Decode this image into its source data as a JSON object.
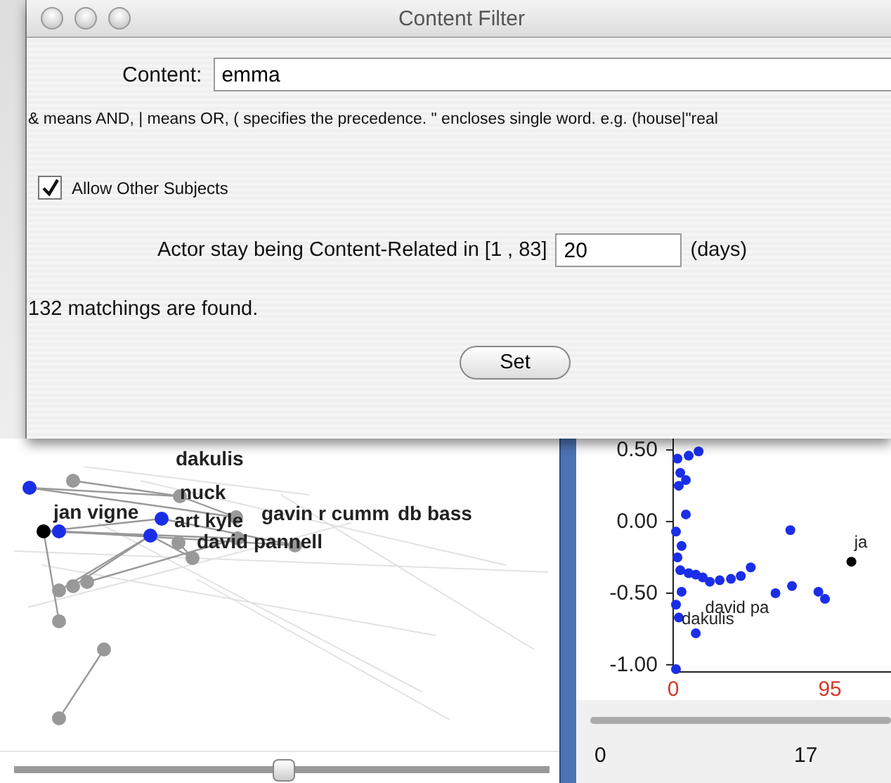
{
  "window": {
    "title": "Content Filter"
  },
  "content_field": {
    "label": "Content:",
    "value": "emma"
  },
  "hint": "& means AND, | means OR, ( specifies the precedence. \" encloses single word. e.g. (house|\"real",
  "allow_other_subjects": {
    "label": "Allow Other Subjects",
    "checked": true
  },
  "duration": {
    "label": "Actor stay being Content-Related in [1 , 83]",
    "value": "20",
    "unit": "(days)"
  },
  "result": "132 matchings are found.",
  "set_button": "Set",
  "network": {
    "labels": [
      "dakulis",
      "nuck",
      "jan vigne",
      "art kyle",
      "gavin r cumm",
      "db bass",
      "david pannell"
    ],
    "slider": {
      "level": 0.5
    }
  },
  "scatter": {
    "chart_data": {
      "type": "scatter",
      "xlim": [
        0,
        132
      ],
      "ylim": [
        -1.05,
        0.56
      ],
      "xticks": [
        {
          "value": 0,
          "label": "0"
        },
        {
          "value": 95,
          "label": "95"
        }
      ],
      "yticks": [
        {
          "value": 0.5,
          "label": "0.50"
        },
        {
          "value": 0,
          "label": "0.00"
        },
        {
          "value": -0.5,
          "label": "-0.50"
        },
        {
          "value": -1,
          "label": "-1.00"
        }
      ],
      "series": [
        {
          "color": "#1a2ee8",
          "x": [
            2.6,
            9.4,
            15.4,
            4.3,
            7.7,
            3.4,
            7.7,
            1.7,
            5.1,
            2.6,
            4.3,
            9.4,
            13.7,
            17.9,
            22.2,
            28.2,
            35,
            41,
            47,
            5.1,
            1.7,
            3.4,
            13.7,
            1.7,
            71,
            62,
            72,
            88,
            92
          ],
          "values": [
            0.44,
            0.46,
            0.49,
            0.34,
            0.29,
            0.25,
            0.05,
            -0.07,
            -0.17,
            -0.25,
            -0.34,
            -0.36,
            -0.37,
            -0.39,
            -0.42,
            -0.41,
            -0.4,
            -0.38,
            -0.32,
            -0.49,
            -0.58,
            -0.67,
            -0.78,
            -1.03,
            -0.06,
            -0.5,
            -0.45,
            -0.49,
            -0.54
          ]
        },
        {
          "color": "#000000",
          "x": [
            108
          ],
          "values": [
            -0.28
          ]
        }
      ],
      "annotations": [
        {
          "x": 1.7,
          "y": -0.58,
          "text": "dakulis"
        },
        {
          "x": 108,
          "y": -0.28,
          "text": "ja"
        },
        {
          "x": 62,
          "y": -0.5,
          "text": "david pa"
        }
      ]
    },
    "slider_ticks": [
      "0",
      "17"
    ]
  }
}
